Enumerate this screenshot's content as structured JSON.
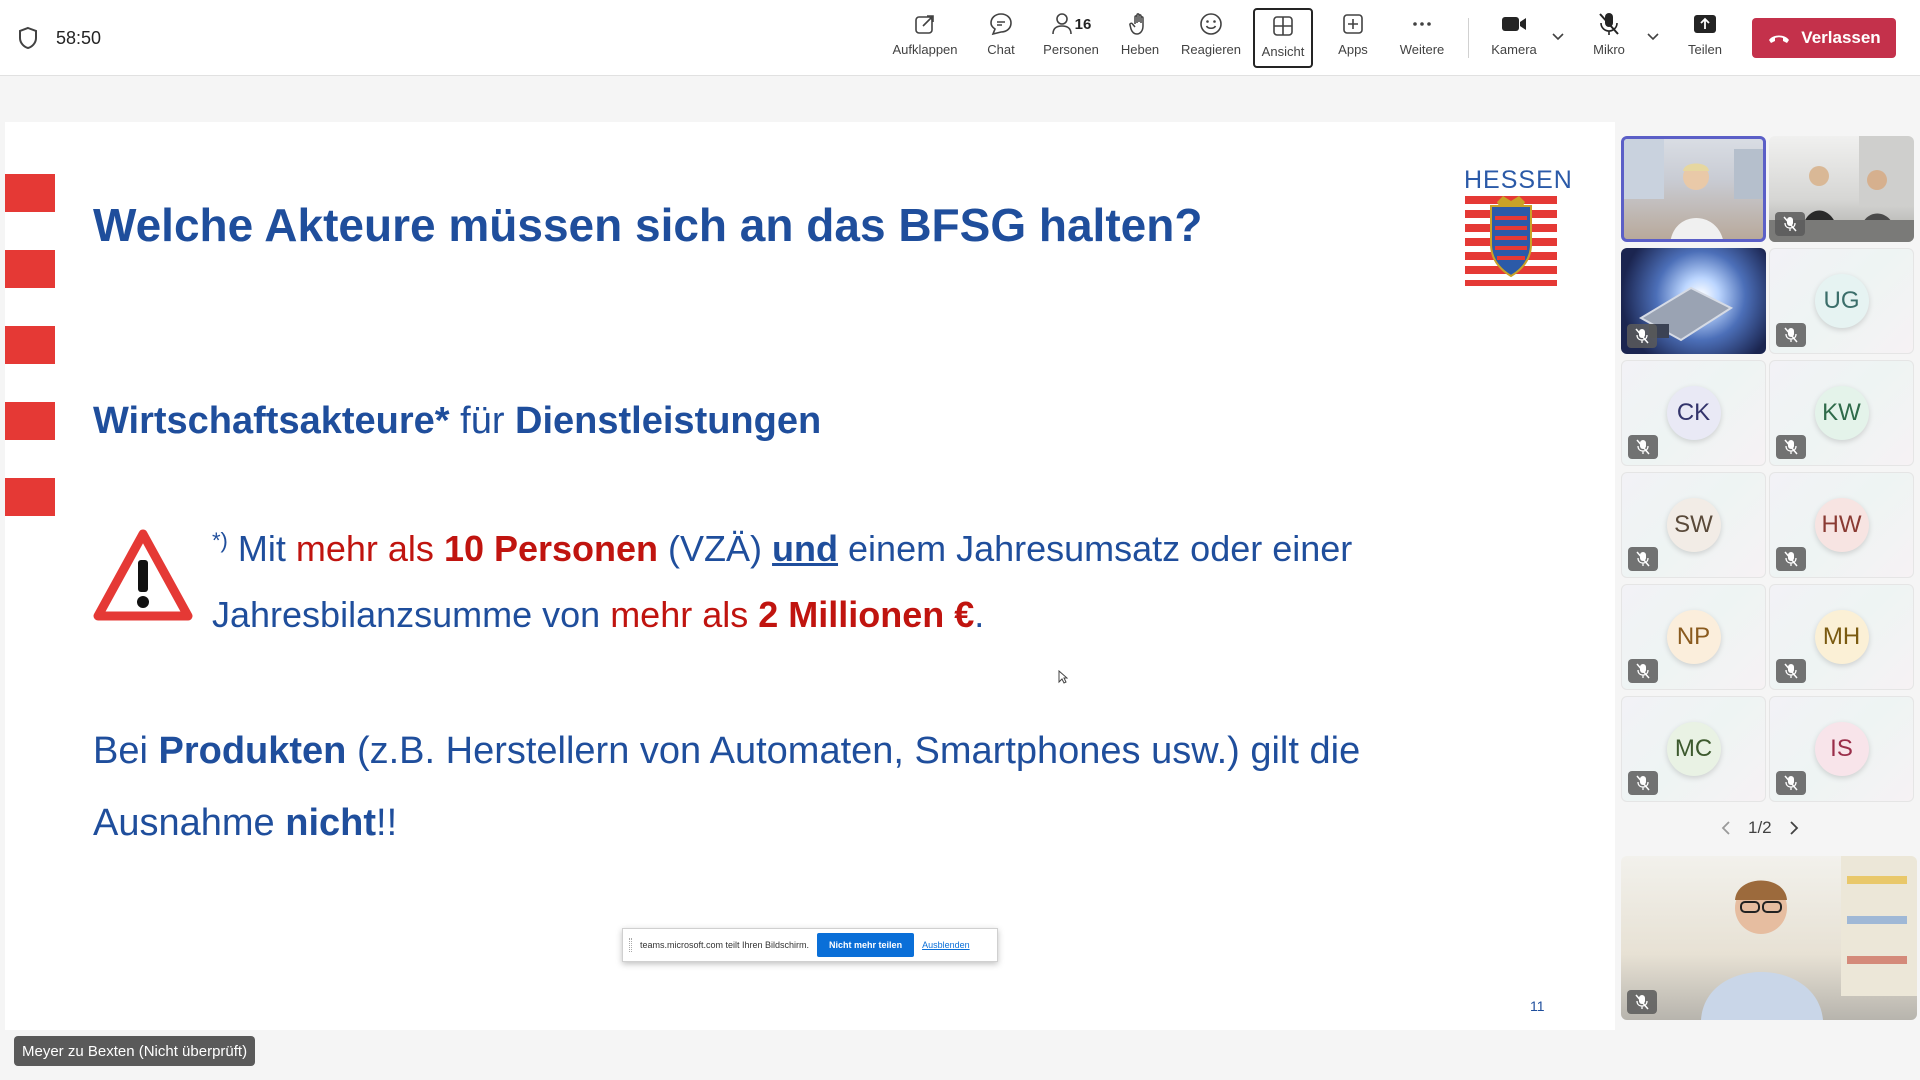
{
  "meeting": {
    "timer": "58:50"
  },
  "toolbar": {
    "buttons": [
      {
        "label": "Aufklappen",
        "icon": "popout-icon"
      },
      {
        "label": "Chat",
        "icon": "chat-icon"
      },
      {
        "label": "Personen",
        "icon": "people-icon",
        "count": "16"
      },
      {
        "label": "Heben",
        "icon": "raise-hand-icon"
      },
      {
        "label": "Reagieren",
        "icon": "react-icon"
      },
      {
        "label": "Ansicht",
        "icon": "view-icon",
        "active": true
      },
      {
        "label": "Apps",
        "icon": "apps-icon"
      },
      {
        "label": "Weitere",
        "icon": "more-icon"
      },
      {
        "label": "Kamera",
        "icon": "camera-icon"
      },
      {
        "label": "Mikro",
        "icon": "mic-off-icon"
      },
      {
        "label": "Teilen",
        "icon": "share-icon"
      }
    ],
    "leave_label": "Verlassen",
    "leave_color": "#c4314b"
  },
  "slide": {
    "title": "Welche Akteure müssen sich an das BFSG halten?",
    "logo_text": "HESSEN",
    "subheading": {
      "part1": "Wirtschaftsakteure*",
      "part2": " für ",
      "part3": "Dienstleistungen"
    },
    "note": {
      "marker": "*)",
      "line1": [
        {
          "text": " Mit ",
          "style": "plain"
        },
        {
          "text": "mehr als ",
          "style": "red"
        },
        {
          "text": "10 Personen",
          "style": "red-bold"
        },
        {
          "text": " (VZÄ) ",
          "style": "plain"
        },
        {
          "text": "und",
          "style": "underline-bold"
        },
        {
          "text": " einem Jahresumsatz oder einer",
          "style": "plain"
        }
      ],
      "line2": [
        {
          "text": "Jahresbilanzsumme von ",
          "style": "plain"
        },
        {
          "text": "mehr als ",
          "style": "red"
        },
        {
          "text": "2 Millionen €",
          "style": "red-bold"
        },
        {
          "text": ".",
          "style": "plain"
        }
      ]
    },
    "products": {
      "line1_a": "Bei ",
      "line1_b": "Produkten",
      "line1_c": " (z.B. Herstellern von Automaten, Smartphones usw.) gilt die",
      "line2_a": "Ausnahme ",
      "line2_b": "nicht",
      "line2_c": "!!"
    },
    "page_number": "11",
    "accent_red": "#e53935",
    "accent_blue": "#1f4e9c"
  },
  "share_notice": {
    "text": "teams.microsoft.com teilt Ihren Bildschirm.",
    "stop_label": "Nicht mehr teilen",
    "hide_label": "Ausblenden"
  },
  "presenter_name": "Meyer zu Bexten (Nicht überprüft)",
  "participants": {
    "video_tiles": 4,
    "avatars": [
      {
        "initials": "UG",
        "color": "#e6f3f2",
        "text_color": "#3b6e6a"
      },
      {
        "initials": "CK",
        "color": "#e9e9f5",
        "text_color": "#33346b"
      },
      {
        "initials": "KW",
        "color": "#e4f3ea",
        "text_color": "#2f6b4a"
      },
      {
        "initials": "SW",
        "color": "#f2ece6",
        "text_color": "#5a4a3a"
      },
      {
        "initials": "HW",
        "color": "#f7e4e2",
        "text_color": "#8a3a33"
      },
      {
        "initials": "NP",
        "color": "#fbeedc",
        "text_color": "#8a5a1e"
      },
      {
        "initials": "MH",
        "color": "#fbf0d6",
        "text_color": "#7a5a10"
      },
      {
        "initials": "MC",
        "color": "#e9f2e4",
        "text_color": "#3d5a2e"
      },
      {
        "initials": "IS",
        "color": "#f8e4ea",
        "text_color": "#9a2e4a"
      }
    ],
    "pager": "1/2"
  }
}
